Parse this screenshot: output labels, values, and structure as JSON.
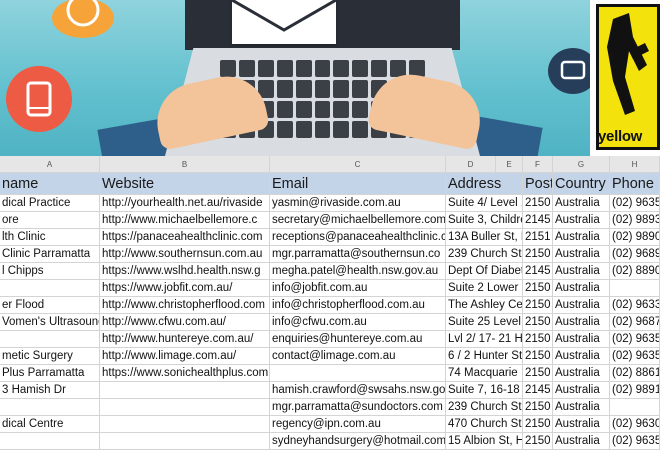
{
  "banner": {
    "brand_label": "yellow",
    "icons": [
      "compass-icon",
      "tablet-icon",
      "envelope-icon",
      "laptop-icon",
      "chat-icon",
      "walking-fingers-logo"
    ]
  },
  "spreadsheet": {
    "column_letters": [
      "A",
      "B",
      "C",
      "D",
      "E",
      "F",
      "G",
      "H"
    ],
    "headers": [
      "name",
      "Website",
      "Email",
      "Address",
      "Post",
      "Country",
      "Phone"
    ],
    "rows": [
      [
        "dical Practice",
        "http://yourhealth.net.au/rivaside",
        "yasmin@rivaside.com.au",
        "Suite 4/ Level 1",
        "2150",
        "Australia",
        "(02) 9635"
      ],
      [
        "ore",
        "http://www.michaelbellemore.c",
        "secretary@michaelbellemore.com",
        "Suite 3, Childre",
        "2145",
        "Australia",
        "(02) 9893"
      ],
      [
        "lth Clinic",
        "https://panaceahealthclinic.com",
        "receptions@panaceahealthclinic.c",
        "13A Buller St, P",
        "2151",
        "Australia",
        "(02) 9890"
      ],
      [
        "Clinic Parramatta",
        "http://www.southernsun.com.au",
        "mgr.parramatta@southernsun.co",
        "239 Church St,",
        "2150",
        "Australia",
        "(02) 9689"
      ],
      [
        "l Chipps",
        "https://www.wslhd.health.nsw.g",
        "megha.patel@health.nsw.gov.au",
        "Dept Of Diabet",
        "2145",
        "Australia",
        "(02) 8890"
      ],
      [
        "",
        "https://www.jobfit.com.au/",
        "info@jobfit.com.au",
        "Suite 2 Lower G",
        "2150",
        "Australia",
        ""
      ],
      [
        "er Flood",
        "http://www.christopherflood.com",
        "info@christopherflood.com.au",
        "The Ashley Cen",
        "2150",
        "Australia",
        "(02) 9633"
      ],
      [
        "Vomen's Ultrasound",
        "http://www.cfwu.com.au/",
        "info@cfwu.com.au",
        "Suite 25 Level",
        "2150",
        "Australia",
        "(02) 9687"
      ],
      [
        "",
        "http://www.huntereye.com.au/",
        "enquiries@huntereye.com.au",
        "Lvl 2/ 17- 21 H",
        "2150",
        "Australia",
        "(02) 9635"
      ],
      [
        "metic Surgery",
        "http://www.limage.com.au/",
        "contact@limage.com.au",
        "6 / 2 Hunter St",
        "2150",
        "Australia",
        "(02) 9635"
      ],
      [
        "Plus Parramatta",
        "https://www.sonichealthplus.com.au/",
        "",
        "74 Macquarie",
        "2150",
        "Australia",
        "(02) 8861"
      ],
      [
        "3 Hamish Dr",
        "",
        "hamish.crawford@swsahs.nsw.go",
        "Suite 7, 16-18",
        "2145",
        "Australia",
        "(02) 9891"
      ],
      [
        "",
        "",
        "mgr.parramatta@sundoctors.com",
        "239 Church St,",
        "2150",
        "Australia",
        ""
      ],
      [
        "dical Centre",
        "",
        "regency@ipn.com.au",
        "470 Church St,",
        "2150",
        "Australia",
        "(02) 9630"
      ],
      [
        "",
        "",
        "sydneyhandsurgery@hotmail.com",
        "15 Albion St, H",
        "2150",
        "Australia",
        "(02) 9635"
      ]
    ]
  }
}
